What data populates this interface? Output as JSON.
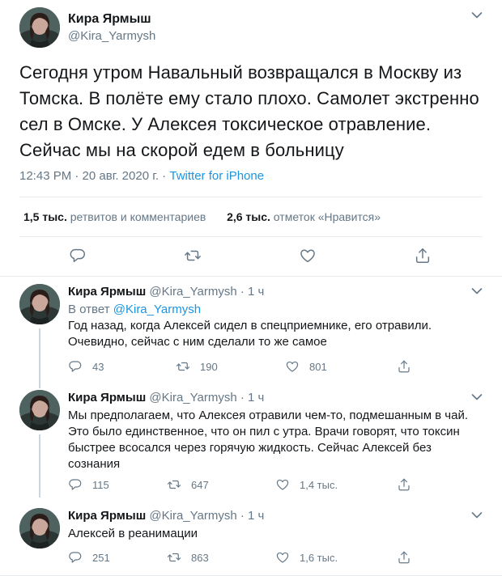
{
  "main_tweet": {
    "author_name": "Кира Ярмыш",
    "author_handle": "@Kira_Yarmysh",
    "text": "Сегодня утром Навальный возвращался в Москву из Томска. В полёте ему стало плохо. Самолет экстренно сел в Омске. У Алексея токсическое отравление. Сейчас мы на скорой едем в больницу",
    "time": "12:43 PM · 20 авг. 2020 г. · ",
    "source": "Twitter for iPhone",
    "retweets_count": "1,5 тыс.",
    "retweets_label": " ретвитов и комментариев",
    "likes_count": "2,6 тыс.",
    "likes_label": " отметок «Нравится»",
    "actions": {
      "reply_icon": "reply-icon",
      "retweet_icon": "retweet-icon",
      "like_icon": "heart-icon",
      "share_icon": "share-icon"
    }
  },
  "replies": [
    {
      "author_name": "Кира Ярмыш",
      "author_handle": "@Kira_Yarmysh",
      "dot": "·",
      "time": "1 ч",
      "reply_to_label": "В ответ ",
      "reply_to_mention": "@Kira_Yarmysh",
      "text": "Год назад, когда Алексей сидел в спецприемнике, его отравили. Очевидно, сейчас с ним сделали то же самое",
      "replies_count": "43",
      "retweets_count": "190",
      "likes_count": "801"
    },
    {
      "author_name": "Кира Ярмыш",
      "author_handle": "@Kira_Yarmysh",
      "dot": "·",
      "time": "1 ч",
      "text": "Мы предполагаем, что Алексея отравили чем-то, подмешанным в чай. Это было единственное, что он пил с утра. Врачи говорят, что токсин быстрее всосался через горячую жидкость. Сейчас Алексей без сознания",
      "replies_count": "115",
      "retweets_count": "647",
      "likes_count": "1,4 тыс."
    },
    {
      "author_name": "Кира Ярмыш",
      "author_handle": "@Kira_Yarmysh",
      "dot": "·",
      "time": "1 ч",
      "text": "Алексей в реанимации",
      "replies_count": "251",
      "retweets_count": "863",
      "likes_count": "1,6 тыс."
    }
  ],
  "colors": {
    "link": "#1b95e0",
    "secondary_text": "#657786",
    "primary_text": "#14171a",
    "border": "#e6ecf0"
  }
}
